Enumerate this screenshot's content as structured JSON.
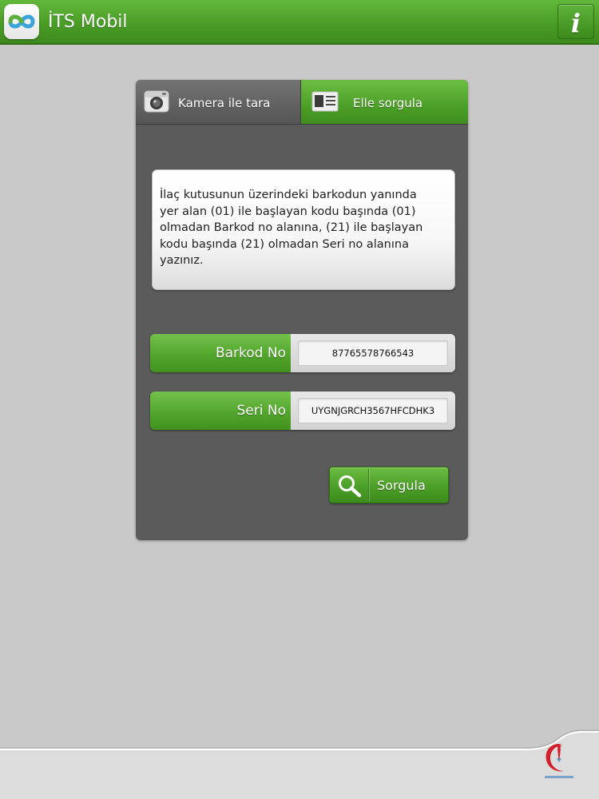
{
  "app": {
    "title": "İTS Mobil",
    "logo_icon": "its-logo-icon",
    "info_icon": "info-icon",
    "info_glyph": "i"
  },
  "tabs": [
    {
      "label": "Kamera ile tara",
      "icon": "camera-icon",
      "active": false
    },
    {
      "label": "Elle sorgula",
      "icon": "card-icon",
      "active": true
    }
  ],
  "instructions": {
    "line1": "İlaç kutusunun üzerindeki barkodun yanında",
    "line2": "yer alan (01) ile başlayan kodu başında (01)",
    "line3": "olmadan Barkod no alanına, (21) ile başlayan",
    "line4": "kodu başında (21) olmadan Seri no alanına",
    "line5": "yazınız."
  },
  "form": {
    "barcode": {
      "label": "Barkod No",
      "value": "87765578766543"
    },
    "serial": {
      "label": "Seri No",
      "value": "UYGNJGRCH3567HFCDHK3"
    }
  },
  "actions": {
    "search_label": "Sorgula",
    "search_icon": "search-icon"
  },
  "footer": {
    "logo": "ministry-of-health-logo"
  },
  "colors": {
    "brand_green": "#4a9d26",
    "panel_gray": "#5b5b5b",
    "background": "#c9c9c9"
  }
}
